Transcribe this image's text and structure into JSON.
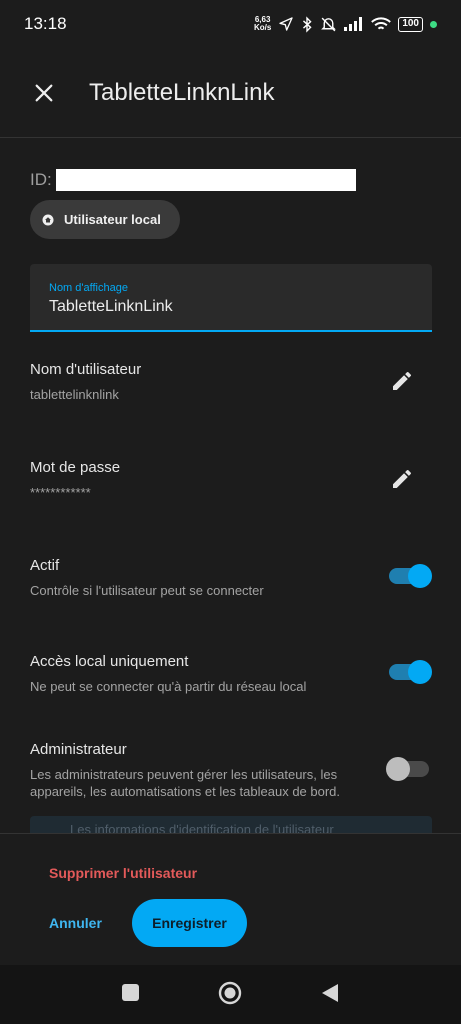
{
  "status_bar": {
    "time": "13:18",
    "speed_value": "6,63",
    "speed_unit": "Ko/s",
    "battery": "100",
    "icons": [
      "location-icon",
      "bluetooth-icon",
      "mute-icon",
      "signal-icon",
      "wifi-icon",
      "battery-icon"
    ]
  },
  "header": {
    "title": "TabletteLinknLink",
    "close_icon": "close-icon"
  },
  "id_row": {
    "label": "ID:",
    "value": ""
  },
  "chip": {
    "label": "Utilisateur local",
    "icon": "home-icon"
  },
  "display_name": {
    "label": "Nom d'affichage",
    "value": "TabletteLinknLink"
  },
  "username": {
    "title": "Nom d'utilisateur",
    "value": "tablettelinknlink",
    "icon": "edit-icon"
  },
  "password": {
    "title": "Mot de passe",
    "value": "************",
    "icon": "edit-icon"
  },
  "active": {
    "title": "Actif",
    "description": "Contrôle si l'utilisateur peut se connecter",
    "enabled": true
  },
  "local_only": {
    "title": "Accès local uniquement",
    "description": "Ne peut se connecter qu'à partir du réseau local",
    "enabled": true
  },
  "admin": {
    "title": "Administrateur",
    "description": "Les administrateurs peuvent gérer les utilisateurs, les appareils, les automatisations et les tableaux de bord.",
    "enabled": false
  },
  "info_banner": {
    "text": "Les informations d'identification de l'utilisateur"
  },
  "footer": {
    "delete_label": "Supprimer l'utilisateur",
    "cancel_label": "Annuler",
    "save_label": "Enregistrer"
  },
  "colors": {
    "accent": "#03a9f4",
    "danger": "#e35a5a",
    "background": "#1c1c1c"
  }
}
